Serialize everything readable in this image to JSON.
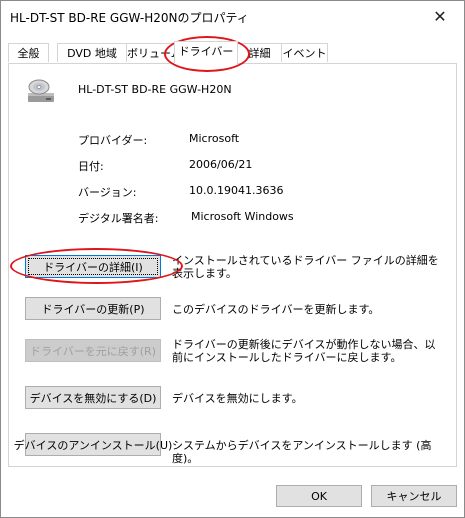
{
  "window": {
    "title": "HL-DT-ST BD-RE  GGW-H20Nのプロパティ",
    "close_glyph": "✕"
  },
  "tabs": [
    {
      "label": "全般"
    },
    {
      "label": "DVD 地域"
    },
    {
      "label": "ボリューム"
    },
    {
      "label": "ドライバー",
      "active": true
    },
    {
      "label": "詳細"
    },
    {
      "label": "イベント"
    }
  ],
  "device": {
    "name": "HL-DT-ST BD-RE  GGW-H20N",
    "icon": "optical-drive-icon"
  },
  "properties": [
    {
      "label": "プロバイダー:",
      "value": "Microsoft"
    },
    {
      "label": "日付:",
      "value": "2006/06/21"
    },
    {
      "label": "バージョン:",
      "value": "10.0.19041.3636"
    },
    {
      "label": "デジタル署名者:",
      "value": "Microsoft Windows"
    }
  ],
  "actions": [
    {
      "label": "ドライバーの詳細(I)",
      "description": "インストールされているドライバー ファイルの詳細を表示します。",
      "enabled": true,
      "focused": true
    },
    {
      "label": "ドライバーの更新(P)",
      "description": "このデバイスのドライバーを更新します。",
      "enabled": true
    },
    {
      "label": "ドライバーを元に戻す(R)",
      "description": "ドライバーの更新後にデバイスが動作しない場合、以前にインストールしたドライバーに戻します。",
      "enabled": false
    },
    {
      "label": "デバイスを無効にする(D)",
      "description": "デバイスを無効にします。",
      "enabled": true
    },
    {
      "label": "デバイスのアンインストール(U)",
      "description": "システムからデバイスをアンインストールします (高度)。",
      "enabled": true
    }
  ],
  "footer": {
    "ok_label": "OK",
    "cancel_label": "キャンセル"
  },
  "colors": {
    "highlight_ring": "#e0151a",
    "focus_border": "#0078d7"
  }
}
